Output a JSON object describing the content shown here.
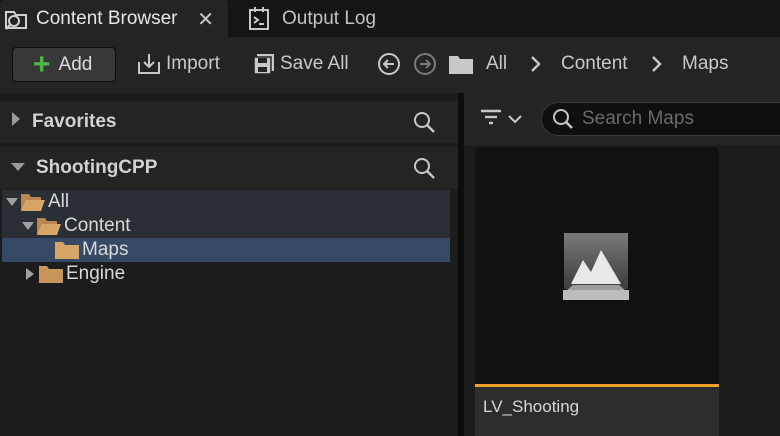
{
  "tabs": [
    {
      "label": "Content Browser",
      "icon": "content-browser-icon",
      "active": true,
      "close": "✕"
    },
    {
      "label": "Output Log",
      "icon": "output-log-icon",
      "active": false
    }
  ],
  "toolbar": {
    "add_label": "Add",
    "import_label": "Import",
    "save_all_label": "Save All"
  },
  "breadcrumb": [
    "All",
    "Content",
    "Maps"
  ],
  "left_panel": {
    "favorites_label": "Favorites",
    "project_label": "ShootingCPP",
    "tree": [
      {
        "label": "All",
        "depth": 0,
        "expanded": true
      },
      {
        "label": "Content",
        "depth": 1,
        "expanded": true
      },
      {
        "label": "Maps",
        "depth": 2,
        "selected": true
      },
      {
        "label": "Engine",
        "depth": 1,
        "expanded": false
      }
    ]
  },
  "right_panel": {
    "search_placeholder": "Search Maps",
    "assets": [
      {
        "name": "LV_Shooting",
        "type_color": "#f0a02a",
        "icon": "level-map-icon"
      }
    ]
  },
  "colors": {
    "accent_add": "#4fb84a",
    "selection": "#364a66",
    "folder": "#c8965a",
    "level_type": "#f0a02a"
  }
}
